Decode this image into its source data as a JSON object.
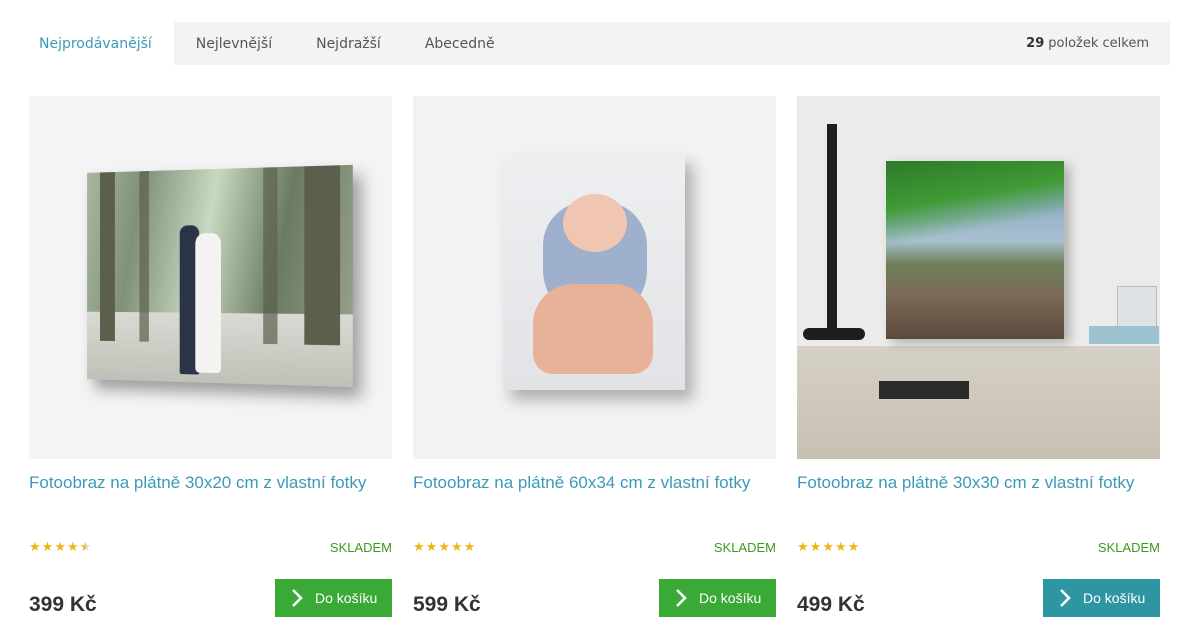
{
  "sort": {
    "tabs": [
      "Nejprodávanější",
      "Nejlevnější",
      "Nejdražší",
      "Abecedně"
    ],
    "active": "Nejprodávanější",
    "total_count": "29",
    "total_suffix": "položek celkem"
  },
  "products": [
    {
      "title": "Fotoobraz na plátně 30x20 cm z vlastní fotky",
      "rating": 4.5,
      "stock": "SKLADEM",
      "price": "399 Kč",
      "cart_label": "Do košíku",
      "button_color": "#3aa935"
    },
    {
      "title": "Fotoobraz na plátně 60x34 cm z vlastní fotky",
      "rating": 5,
      "stock": "SKLADEM",
      "price": "599 Kč",
      "cart_label": "Do košíku",
      "button_color": "#3aa935"
    },
    {
      "title": "Fotoobraz na plátně 30x30 cm z vlastní fotky",
      "rating": 5,
      "stock": "SKLADEM",
      "price": "499 Kč",
      "cart_label": "Do košíku",
      "button_color": "#2e96a3"
    }
  ],
  "colors": {
    "accent": "#3c9ab8",
    "stock_green": "#3b9b1d",
    "star": "#f2b318"
  },
  "icons": {
    "star": "star-icon",
    "cart_arrow": "chevron-right-icon"
  }
}
